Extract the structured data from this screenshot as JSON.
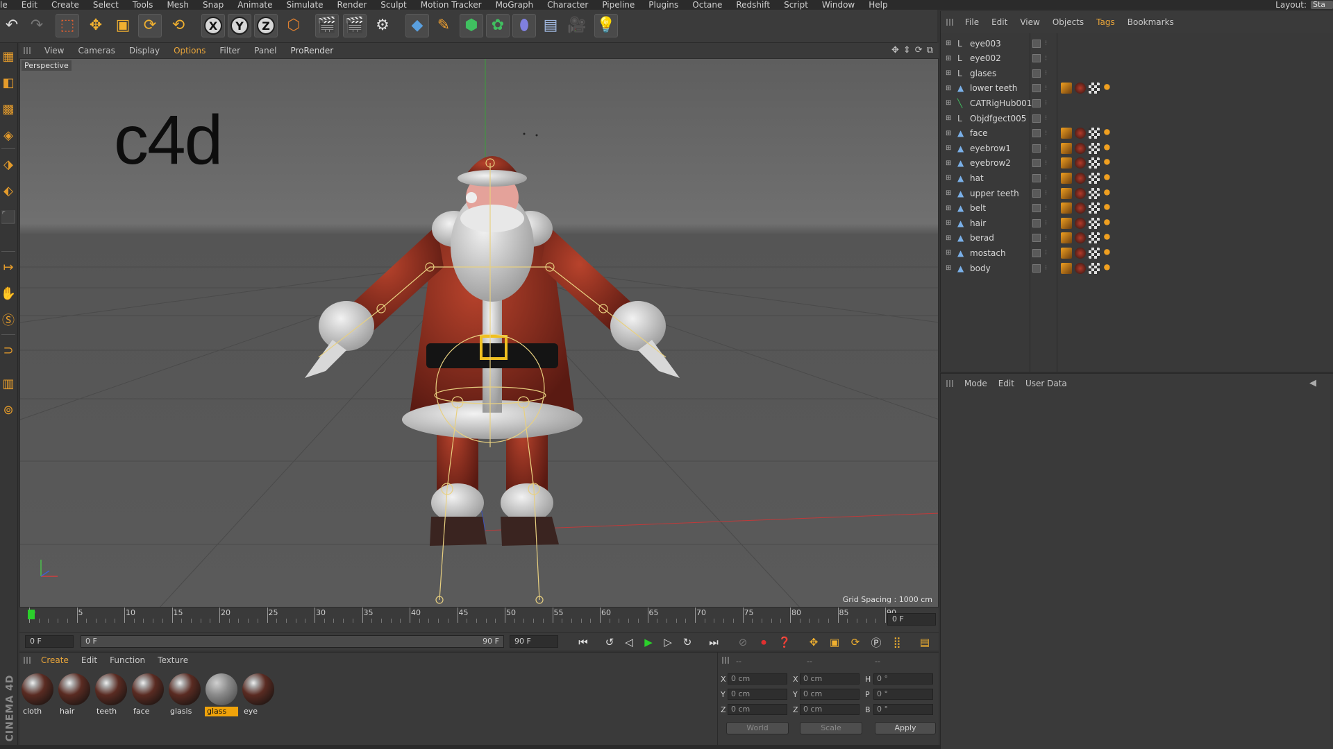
{
  "menubar": {
    "items": [
      "le",
      "Edit",
      "Create",
      "Select",
      "Tools",
      "Mesh",
      "Snap",
      "Animate",
      "Simulate",
      "Render",
      "Sculpt",
      "Motion Tracker",
      "MoGraph",
      "Character",
      "Pipeline",
      "Plugins",
      "Octane",
      "Redshift",
      "Script",
      "Window",
      "Help"
    ],
    "layout_label": "Layout:",
    "layout_value": "Sta"
  },
  "viewport": {
    "menu": [
      "View",
      "Cameras",
      "Display",
      "Options",
      "Filter",
      "Panel",
      "ProRender"
    ],
    "active_menu": "Options",
    "label": "Perspective",
    "overlay_text": "c4d",
    "grid_spacing": "Grid Spacing : 1000 cm"
  },
  "timeline": {
    "ticks": [
      "0",
      "5",
      "10",
      "15",
      "20",
      "25",
      "30",
      "35",
      "40",
      "45",
      "50",
      "55",
      "60",
      "65",
      "70",
      "75",
      "80",
      "85",
      "90"
    ],
    "current_frame_field": "0 F",
    "start_field": "0 F",
    "range_start": "0 F",
    "range_end": "90 F",
    "end_field": "90 F"
  },
  "materials": {
    "menu": [
      "Create",
      "Edit",
      "Function",
      "Texture"
    ],
    "active_menu": "Create",
    "items": [
      {
        "name": "cloth"
      },
      {
        "name": "hair"
      },
      {
        "name": "teeth"
      },
      {
        "name": "face"
      },
      {
        "name": "glasis"
      },
      {
        "name": "glass",
        "selected": true
      },
      {
        "name": "eye"
      }
    ]
  },
  "coords": {
    "header": [
      "--",
      "--",
      "--"
    ],
    "rows": [
      {
        "a": "X",
        "av": "0 cm",
        "b": "X",
        "bv": "0 cm",
        "c": "H",
        "cv": "0 °"
      },
      {
        "a": "Y",
        "av": "0 cm",
        "b": "Y",
        "bv": "0 cm",
        "c": "P",
        "cv": "0 °"
      },
      {
        "a": "Z",
        "av": "0 cm",
        "b": "Z",
        "bv": "0 cm",
        "c": "B",
        "cv": "0 °"
      }
    ],
    "world": "World",
    "scale": "Scale",
    "apply": "Apply"
  },
  "brand": "CINEMA 4D",
  "objects": {
    "menu": [
      "File",
      "Edit",
      "View",
      "Objects",
      "Tags",
      "Bookmarks"
    ],
    "active_menu": "Tags",
    "rows": [
      {
        "name": "eye003",
        "icon": "null-icon",
        "tags": false
      },
      {
        "name": "eye002",
        "icon": "null-icon",
        "tags": false
      },
      {
        "name": "glases",
        "icon": "null-icon",
        "tags": false
      },
      {
        "name": "lower teeth",
        "icon": "mesh-icon",
        "tags": true
      },
      {
        "name": "CATRigHub001",
        "icon": "bone-icon",
        "tags": false
      },
      {
        "name": "Objdfgect005",
        "icon": "null-icon",
        "tags": false
      },
      {
        "name": "face",
        "icon": "mesh-icon",
        "tags": true
      },
      {
        "name": "eyebrow1",
        "icon": "mesh-icon",
        "tags": true
      },
      {
        "name": "eyebrow2",
        "icon": "mesh-icon",
        "tags": true
      },
      {
        "name": "hat",
        "icon": "mesh-icon",
        "tags": true
      },
      {
        "name": "upper teeth",
        "icon": "mesh-icon",
        "tags": true
      },
      {
        "name": "belt",
        "icon": "mesh-icon",
        "tags": true
      },
      {
        "name": "hair",
        "icon": "mesh-icon",
        "tags": true
      },
      {
        "name": "berad",
        "icon": "mesh-icon",
        "tags": true
      },
      {
        "name": "mostach",
        "icon": "mesh-icon",
        "tags": true
      },
      {
        "name": "body",
        "icon": "mesh-icon",
        "tags": true
      }
    ]
  },
  "attributes": {
    "menu": [
      "Mode",
      "Edit",
      "User Data"
    ]
  },
  "colors": {
    "accent": "#e9a53a",
    "selected_material": "#f0a30a"
  }
}
